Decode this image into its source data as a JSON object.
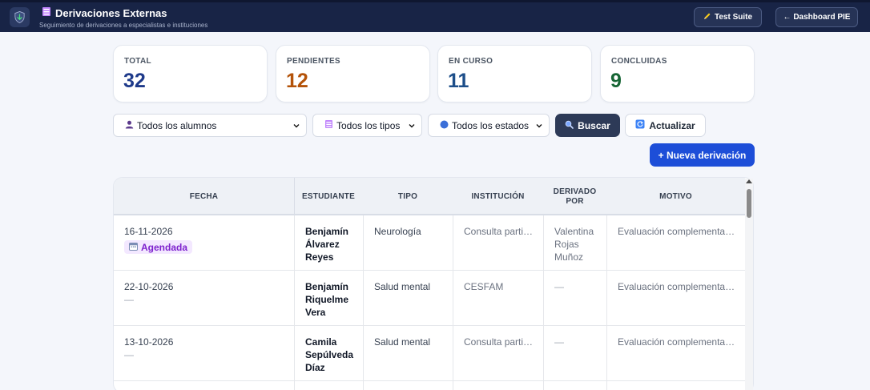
{
  "header": {
    "title": "Derivaciones Externas",
    "subtitle": "Seguimiento de derivaciones a especialistas e instituciones",
    "test_suite_label": "Test Suite",
    "dashboard_label": "← Dashboard PIE"
  },
  "stats": [
    {
      "label": "TOTAL",
      "value": "32",
      "color": "#1e3a8a"
    },
    {
      "label": "PENDIENTES",
      "value": "12",
      "color": "#b45309"
    },
    {
      "label": "EN CURSO",
      "value": "11",
      "color": "#1d4e89"
    },
    {
      "label": "CONCLUIDAS",
      "value": "9",
      "color": "#166534"
    }
  ],
  "filters": {
    "alumnos": "Todos los alumnos",
    "tipos": "Todos los tipos",
    "estados": "Todos los estados",
    "buscar_label": "Buscar",
    "actualizar_label": "Actualizar",
    "nueva_label": "+ Nueva derivación"
  },
  "table": {
    "columns": [
      "FECHA",
      "ESTUDIANTE",
      "TIPO",
      "INSTITUCIÓN",
      "DERIVADO POR",
      "MOTIVO"
    ],
    "rows": [
      {
        "fecha": "16-11-2026",
        "estado": "Agendada",
        "estudiante": "Benjamín Álvarez Reyes",
        "tipo": "Neurología",
        "institucion": "Consulta particular",
        "derivado_por": "Valentina Rojas Muñoz",
        "motivo": "Evaluación complementaria"
      },
      {
        "fecha": "22-10-2026",
        "estado": "—",
        "estudiante": "Benjamín Riquelme Vera",
        "tipo": "Salud mental",
        "institucion": "CESFAM",
        "derivado_por": "—",
        "motivo": "Evaluación complementaria"
      },
      {
        "fecha": "13-10-2026",
        "estado": "—",
        "estudiante": "Camila Sepúlveda Díaz",
        "tipo": "Salud mental",
        "institucion": "Consulta particular",
        "derivado_por": "—",
        "motivo": "Evaluación complementaria"
      }
    ]
  },
  "colors": {
    "header_bg": "#182446",
    "primary_button": "#1d4ed8",
    "dark_button": "#2d3a57",
    "badge_bg": "#f3e8ff",
    "badge_text": "#7e22ce"
  }
}
